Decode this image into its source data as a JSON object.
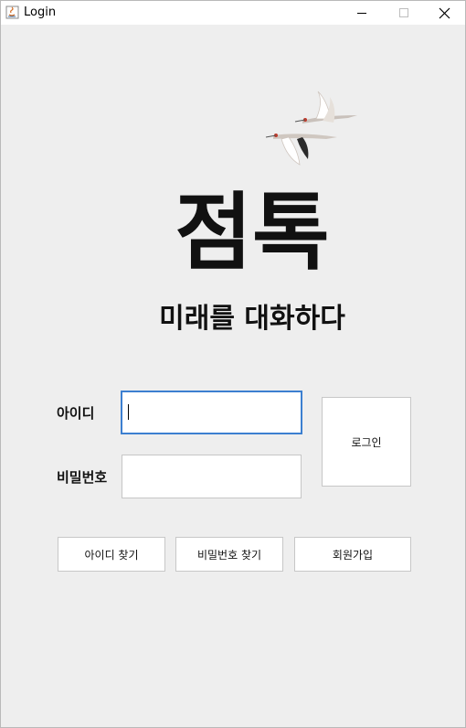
{
  "window": {
    "title": "Login"
  },
  "logo": {
    "main_text": "점톡",
    "tagline": "미래를 대화하다",
    "birds": "crane-birds-illustration"
  },
  "form": {
    "id_label": "아이디",
    "id_value": "",
    "pw_label": "비밀번호",
    "pw_value": ""
  },
  "buttons": {
    "login": "로그인",
    "find_id": "아이디 찾기",
    "find_pw": "비밀번호 찾기",
    "signup": "회원가입"
  },
  "colors": {
    "background": "#eeeeee",
    "focus_border": "#3c7fd0",
    "button_bg": "#ffffff"
  }
}
